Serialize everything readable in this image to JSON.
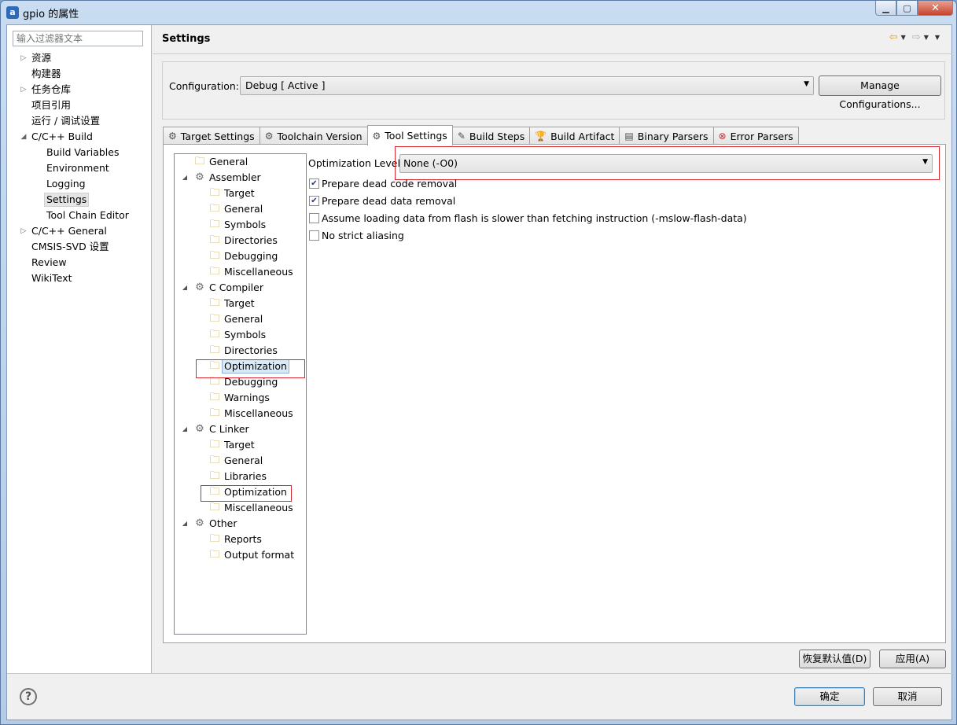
{
  "window": {
    "title": "gpio 的属性",
    "app_icon": "a"
  },
  "filter": {
    "placeholder": "输入过滤器文本"
  },
  "left_tree": [
    {
      "label": "资源",
      "indent": 0,
      "expander": "▷"
    },
    {
      "label": "构建器",
      "indent": 0,
      "expander": ""
    },
    {
      "label": "任务仓库",
      "indent": 0,
      "expander": "▷"
    },
    {
      "label": "项目引用",
      "indent": 0,
      "expander": ""
    },
    {
      "label": "运行 / 调试设置",
      "indent": 0,
      "expander": ""
    },
    {
      "label": "C/C++ Build",
      "indent": 0,
      "expander": "◢"
    },
    {
      "label": "Build Variables",
      "indent": 1,
      "expander": ""
    },
    {
      "label": "Environment",
      "indent": 1,
      "expander": ""
    },
    {
      "label": "Logging",
      "indent": 1,
      "expander": ""
    },
    {
      "label": "Settings",
      "indent": 1,
      "expander": "",
      "selected": true
    },
    {
      "label": "Tool Chain Editor",
      "indent": 1,
      "expander": ""
    },
    {
      "label": "C/C++ General",
      "indent": 0,
      "expander": "▷"
    },
    {
      "label": "CMSIS-SVD 设置",
      "indent": 0,
      "expander": ""
    },
    {
      "label": "Review",
      "indent": 0,
      "expander": ""
    },
    {
      "label": "WikiText",
      "indent": 0,
      "expander": ""
    }
  ],
  "header": {
    "title": "Settings"
  },
  "configuration": {
    "label": "Configuration:",
    "value": "Debug  [ Active ]",
    "manage_button": "Manage Configurations..."
  },
  "tabs": [
    {
      "label": "Target Settings",
      "icon": "gear-icon",
      "active": false
    },
    {
      "label": "Toolchain Version",
      "icon": "gear-icon",
      "active": false
    },
    {
      "label": "Tool Settings",
      "icon": "tool-icon",
      "active": true
    },
    {
      "label": "Build Steps",
      "icon": "build-steps-icon",
      "active": false
    },
    {
      "label": "Build Artifact",
      "icon": "trophy-icon",
      "active": false
    },
    {
      "label": "Binary Parsers",
      "icon": "binary-icon",
      "active": false
    },
    {
      "label": "Error Parsers",
      "icon": "error-icon",
      "active": false
    }
  ],
  "tool_tree": [
    {
      "label": "General",
      "level": 0,
      "category": false
    },
    {
      "label": "Assembler",
      "level": 0,
      "category": true
    },
    {
      "label": "Target",
      "level": 1,
      "category": false
    },
    {
      "label": "General",
      "level": 1,
      "category": false
    },
    {
      "label": "Symbols",
      "level": 1,
      "category": false
    },
    {
      "label": "Directories",
      "level": 1,
      "category": false
    },
    {
      "label": "Debugging",
      "level": 1,
      "category": false
    },
    {
      "label": "Miscellaneous",
      "level": 1,
      "category": false
    },
    {
      "label": "C Compiler",
      "level": 0,
      "category": true
    },
    {
      "label": "Target",
      "level": 1,
      "category": false
    },
    {
      "label": "General",
      "level": 1,
      "category": false
    },
    {
      "label": "Symbols",
      "level": 1,
      "category": false
    },
    {
      "label": "Directories",
      "level": 1,
      "category": false
    },
    {
      "label": "Optimization",
      "level": 1,
      "category": false,
      "selected": true
    },
    {
      "label": "Debugging",
      "level": 1,
      "category": false
    },
    {
      "label": "Warnings",
      "level": 1,
      "category": false
    },
    {
      "label": "Miscellaneous",
      "level": 1,
      "category": false
    },
    {
      "label": "C Linker",
      "level": 0,
      "category": true
    },
    {
      "label": "Target",
      "level": 1,
      "category": false
    },
    {
      "label": "General",
      "level": 1,
      "category": false
    },
    {
      "label": "Libraries",
      "level": 1,
      "category": false
    },
    {
      "label": "Optimization",
      "level": 1,
      "category": false
    },
    {
      "label": "Miscellaneous",
      "level": 1,
      "category": false
    },
    {
      "label": "Other",
      "level": 0,
      "category": true
    },
    {
      "label": "Reports",
      "level": 1,
      "category": false
    },
    {
      "label": "Output format",
      "level": 1,
      "category": false
    }
  ],
  "optimization": {
    "label": "Optimization Level",
    "value": "None (-O0)",
    "options": [
      {
        "label": "Prepare dead code removal",
        "checked": true
      },
      {
        "label": "Prepare dead data removal",
        "checked": true
      },
      {
        "label": "Assume loading data from flash is slower than fetching instruction (-mslow-flash-data)",
        "checked": false
      },
      {
        "label": "No strict aliasing",
        "checked": false
      }
    ]
  },
  "buttons": {
    "restore_defaults": "恢复默认值(D)",
    "apply": "应用(A)",
    "ok": "确定",
    "cancel": "取消"
  },
  "colors": {
    "highlight_box": "#d9272e",
    "selection_bg": "#dbe9f7"
  }
}
